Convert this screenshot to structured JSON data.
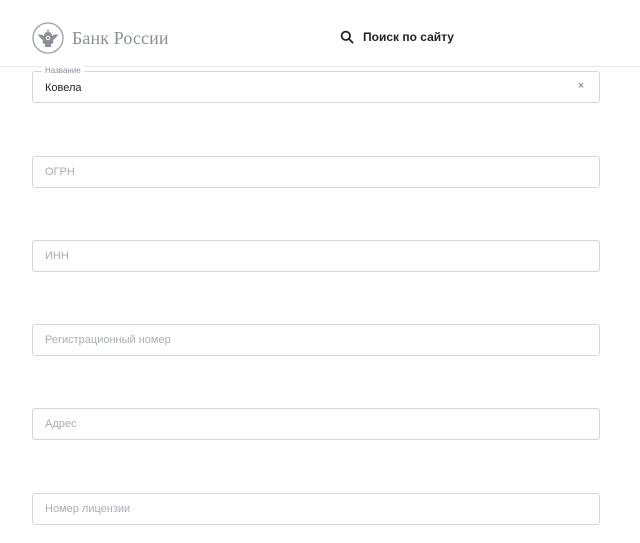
{
  "header": {
    "logo_text": "Банк России",
    "search_label": "Поиск по сайту"
  },
  "fields": [
    {
      "label": "Название",
      "value": "Ковела",
      "placeholder": "",
      "clear_icon": "×"
    },
    {
      "value": "",
      "placeholder": "ОГРН"
    },
    {
      "value": "",
      "placeholder": "ИНН"
    },
    {
      "value": "",
      "placeholder": "Регистрационный номер"
    },
    {
      "value": "",
      "placeholder": "Адрес"
    },
    {
      "value": "",
      "placeholder": "Номер лицензии"
    }
  ],
  "icons": {
    "logo": "double-headed-eagle-emblem",
    "search": "search-icon",
    "clear": "close-icon"
  },
  "colors": {
    "logo_text": "#8a8f96",
    "field_border": "#d4d6da",
    "placeholder": "#a9adb3",
    "text": "#1f2227"
  }
}
